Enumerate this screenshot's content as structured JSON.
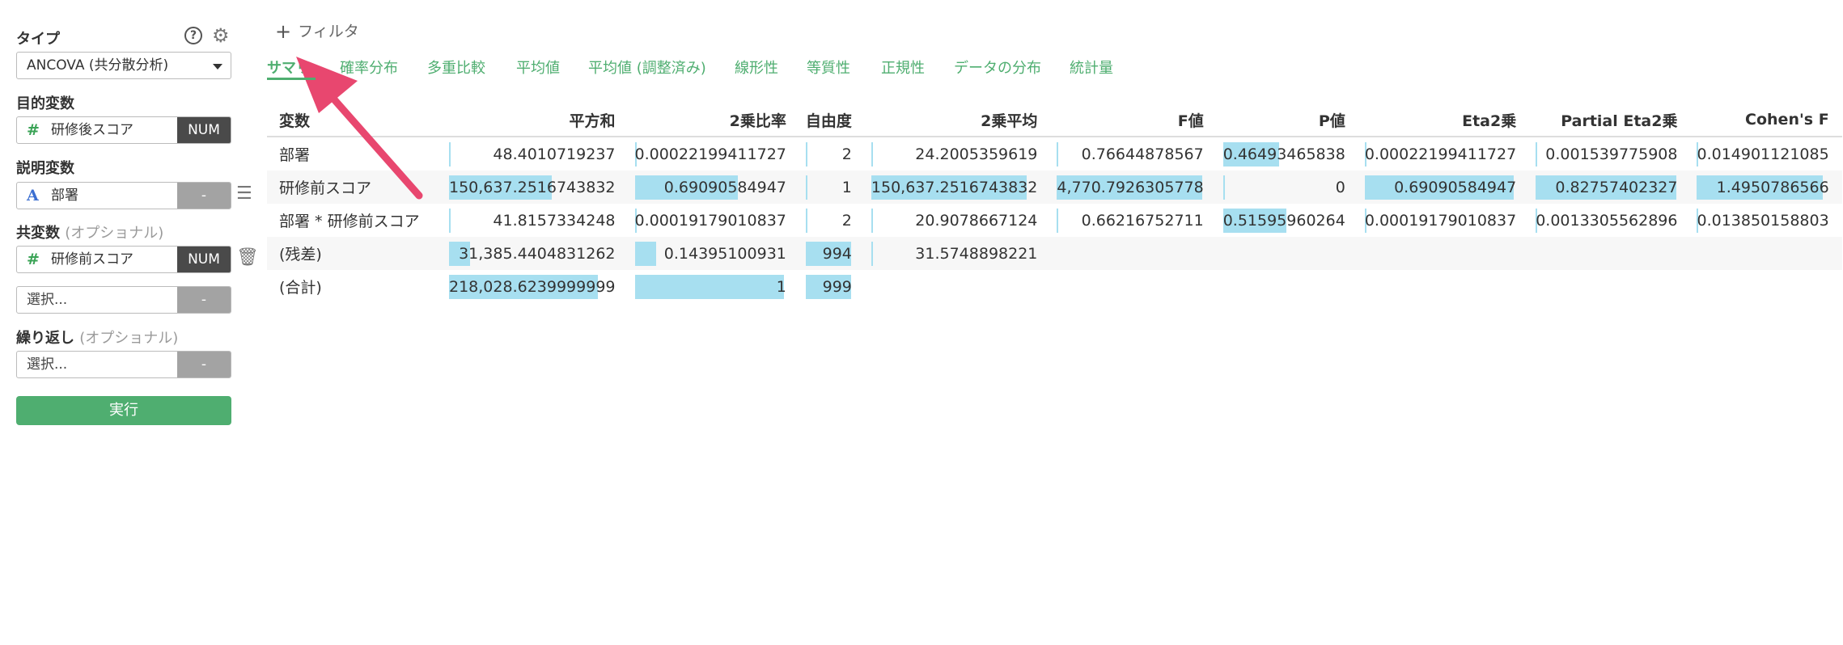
{
  "left_panel": {
    "type_label": "タイプ",
    "type_value": "ANCOVA (共分散分析)",
    "target_label": "目的変数",
    "target_var": {
      "icon": "hash-icon",
      "name": "研修後スコア",
      "tag": "NUM"
    },
    "explanatory_label": "説明変数",
    "explanatory_var": {
      "icon": "letter-a-icon",
      "name": "部署",
      "tag": "-"
    },
    "covariate_label": "共変数",
    "covariate_optional": "(オプショナル)",
    "covariate_var": {
      "icon": "hash-icon",
      "name": "研修前スコア",
      "tag": "NUM"
    },
    "covariate_empty": {
      "placeholder": "選択...",
      "tag": "-"
    },
    "repeat_label": "繰り返し",
    "repeat_optional": "(オプショナル)",
    "repeat_field": {
      "placeholder": "選択...",
      "tag": "-"
    },
    "run_button": "実行"
  },
  "filter": {
    "label": "フィルタ"
  },
  "tabs": [
    {
      "label": "サマリ",
      "active": true
    },
    {
      "label": "確率分布"
    },
    {
      "label": "多重比較"
    },
    {
      "label": "平均値"
    },
    {
      "label": "平均値 (調整済み)"
    },
    {
      "label": "線形性"
    },
    {
      "label": "等質性"
    },
    {
      "label": "正規性"
    },
    {
      "label": "データの分布"
    },
    {
      "label": "統計量"
    }
  ],
  "table": {
    "columns": [
      "変数",
      "平方和",
      "2乗比率",
      "自由度",
      "2乗平均",
      "F値",
      "P値",
      "Eta2乗",
      "Partial Eta2乗",
      "Cohen's F"
    ],
    "rows": [
      [
        "部署",
        "48.4010719237",
        "0.00022199411727",
        "2",
        "24.2005359619",
        "0.76644878567",
        "0.46493465838",
        "0.00022199411727",
        "0.001539775908",
        "0.014901121085"
      ],
      [
        "研修前スコア",
        "150,637.2516743832",
        "0.69090584947",
        "1",
        "150,637.2516743832",
        "4,770.7926305778",
        "0",
        "0.69090584947",
        "0.82757402327",
        "1.4950786566"
      ],
      [
        "部署 * 研修前スコア",
        "41.8157334248",
        "0.00019179010837",
        "2",
        "20.9078667124",
        "0.66216752711",
        "0.51595960264",
        "0.00019179010837",
        "0.0013305562896",
        "0.013850158803"
      ],
      [
        "(残差)",
        "31,385.4404831262",
        "0.14395100931",
        "994",
        "31.5748898221",
        "",
        "",
        "",
        "",
        ""
      ],
      [
        "(合計)",
        "218,028.6239999999",
        "1",
        "999",
        "",
        "",
        "",
        "",
        "",
        ""
      ]
    ],
    "bar_fractions": [
      [
        null,
        0.0002,
        0.0002,
        0.002,
        0.0002,
        0.0002,
        0.46,
        0.0003,
        0.002,
        0.01
      ],
      [
        null,
        0.69,
        0.69,
        0.001,
        1.0,
        1.0,
        0.0,
        1.0,
        1.0,
        1.0
      ],
      [
        null,
        0.0002,
        0.0002,
        0.002,
        0.0001,
        0.0001,
        0.52,
        0.0003,
        0.002,
        0.01
      ],
      [
        null,
        0.14,
        0.14,
        0.995,
        0.0002,
        null,
        null,
        null,
        null,
        null
      ],
      [
        null,
        1.0,
        1.0,
        1.0,
        null,
        null,
        null,
        null,
        null,
        null
      ]
    ],
    "bar_color": "#a7dff0"
  },
  "colors": {
    "accent": "#4fae70",
    "arrow": "#e8476f",
    "tag_dark": "#4a4a4a",
    "tag_gray": "#a3a3a3"
  }
}
